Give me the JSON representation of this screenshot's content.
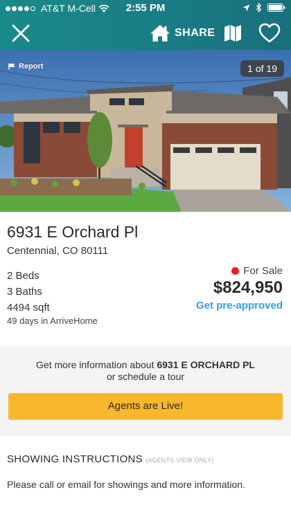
{
  "status_bar": {
    "carrier": "AT&T M-Cell",
    "time": "2:55 PM"
  },
  "header": {
    "share_label": "SHARE",
    "icons": [
      "close-icon",
      "home-icon",
      "map-icon",
      "heart-icon"
    ]
  },
  "photo": {
    "report_label": "Report",
    "counter": "1 of 19"
  },
  "listing": {
    "address": "6931 E Orchard Pl",
    "city": "Centennial, CO 80111",
    "beds": "2 Beds",
    "baths": "3 Baths",
    "sqft": "4494 sqft",
    "days": "49 days in ArriveHome",
    "status": "For Sale",
    "status_color": "#e32020",
    "price": "$824,950",
    "preapproved_label": "Get pre-approved"
  },
  "agents": {
    "info_prefix": "Get more information about ",
    "info_address": "6931 E ORCHARD PL",
    "info_suffix": "or schedule a tour",
    "button_label": "Agents are Live!",
    "button_color": "#f7b82b"
  },
  "showing": {
    "title": "SHOWING INSTRUCTIONS",
    "note": "(AGENTS VIEW ONLY)",
    "text": "Please call or email for showings and more information."
  },
  "colors": {
    "header": "#197d85",
    "link": "#2aa3e0"
  }
}
